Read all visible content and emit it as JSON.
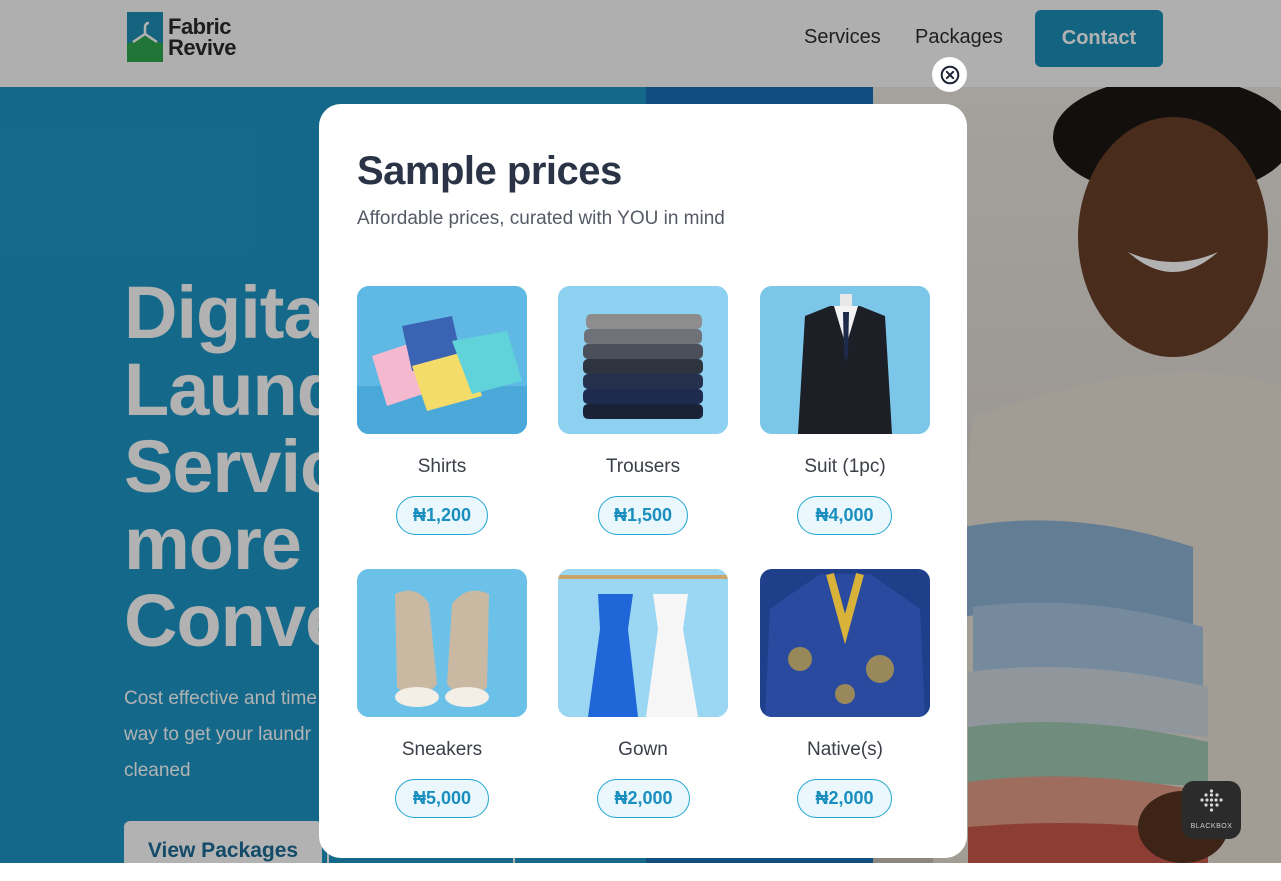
{
  "header": {
    "logo": {
      "line1": "Fabric",
      "line2": "Revive"
    },
    "nav": [
      {
        "label": "Services"
      },
      {
        "label": "Packages"
      }
    ],
    "contact_label": "Contact"
  },
  "hero": {
    "title": "Digita\nLaund\nServic\nmore\nConve",
    "subtitle": "Cost effective and time\nway to get your laundr\ncleaned",
    "primary_button": "View Packages"
  },
  "modal": {
    "title": "Sample prices",
    "subtitle": "Affordable prices, curated with YOU in mind",
    "items": [
      {
        "name": "Shirts",
        "price": "₦1,200"
      },
      {
        "name": "Trousers",
        "price": "₦1,500"
      },
      {
        "name": "Suit (1pc)",
        "price": "₦4,000"
      },
      {
        "name": "Sneakers",
        "price": "₦5,000"
      },
      {
        "name": "Gown",
        "price": "₦2,000"
      },
      {
        "name": "Native(s)",
        "price": "₦2,000"
      }
    ]
  },
  "widget": {
    "label": "BLACKBOX"
  },
  "colors": {
    "accent": "#1a90b8",
    "hero_bg": "#1e97c7",
    "title_text": "#2b3446",
    "pill_border": "#23a6d0",
    "pill_bg": "#eaf7fc"
  },
  "icons": {
    "close": "close-circle-icon",
    "logo": "hanger-logo-icon"
  }
}
